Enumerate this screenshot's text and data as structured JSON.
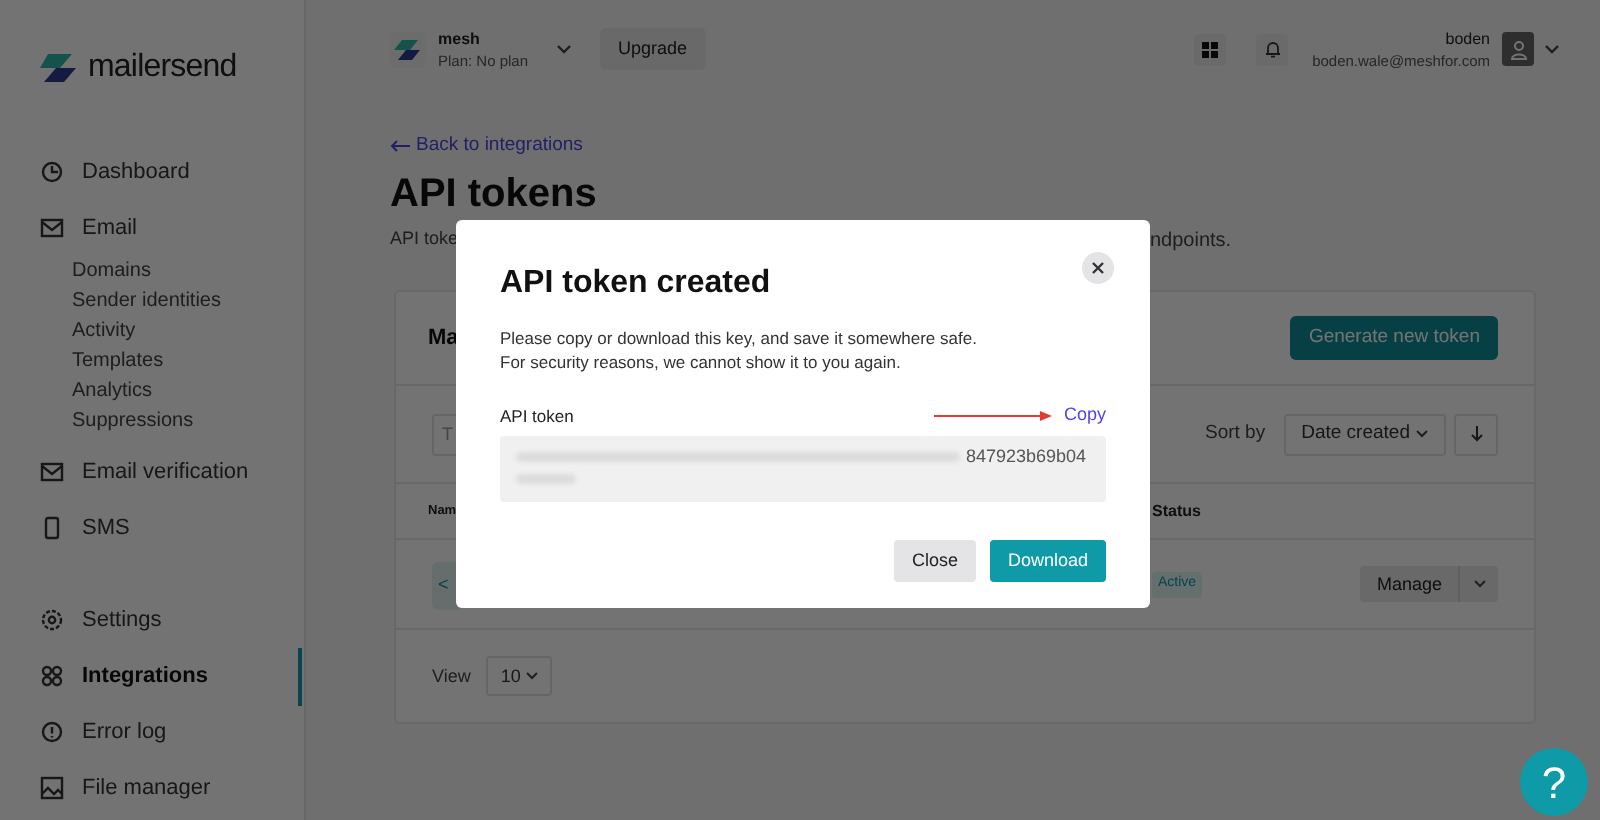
{
  "sidebar": {
    "brand": "mailersend",
    "sections": [
      {
        "items": [
          {
            "label": "Dashboard",
            "selected": false
          },
          {
            "label": "Email",
            "selected": false,
            "children": [
              {
                "label": "Domains"
              },
              {
                "label": "Sender identities"
              },
              {
                "label": "Activity"
              },
              {
                "label": "Templates"
              },
              {
                "label": "Analytics"
              },
              {
                "label": "Suppressions"
              }
            ]
          },
          {
            "label": "Email verification",
            "selected": false
          },
          {
            "label": "SMS",
            "selected": false
          }
        ]
      },
      {
        "items": [
          {
            "label": "Settings",
            "selected": false
          },
          {
            "label": "Integrations",
            "selected": true
          },
          {
            "label": "Error log",
            "selected": false
          },
          {
            "label": "File manager",
            "selected": false
          }
        ]
      }
    ]
  },
  "topbar": {
    "workspace": {
      "name": "mesh",
      "plan": "Plan: No plan"
    },
    "upgrade": "Upgrade",
    "user": {
      "name": "boden",
      "email": "boden.wale@meshfor.com"
    }
  },
  "page": {
    "back_link": "Back to integrations",
    "title": "API tokens",
    "description_parts": [
      "API toke",
      "ndpoints."
    ]
  },
  "card": {
    "title": "Ma",
    "generate_button": "Generate new token",
    "search_placeholder": "T",
    "sort_label": "Sort by",
    "sort_value": "Date created",
    "columns": [
      "Nam",
      "Status"
    ],
    "rows": [
      {
        "name": "<",
        "status": "Active",
        "action": "Manage"
      }
    ],
    "view_label": "View",
    "view_value": "10"
  },
  "modal": {
    "title": "API token created",
    "text": [
      "Please copy or download this key, and save it somewhere safe.",
      "For security reasons, we cannot show it to you again."
    ],
    "token_label": "API token",
    "copy": "Copy",
    "token_visible": "847923b69b04",
    "buttons": [
      {
        "label": "Close",
        "kind": "secondary"
      },
      {
        "label": "Download",
        "kind": "primary"
      }
    ]
  },
  "help": "?"
}
